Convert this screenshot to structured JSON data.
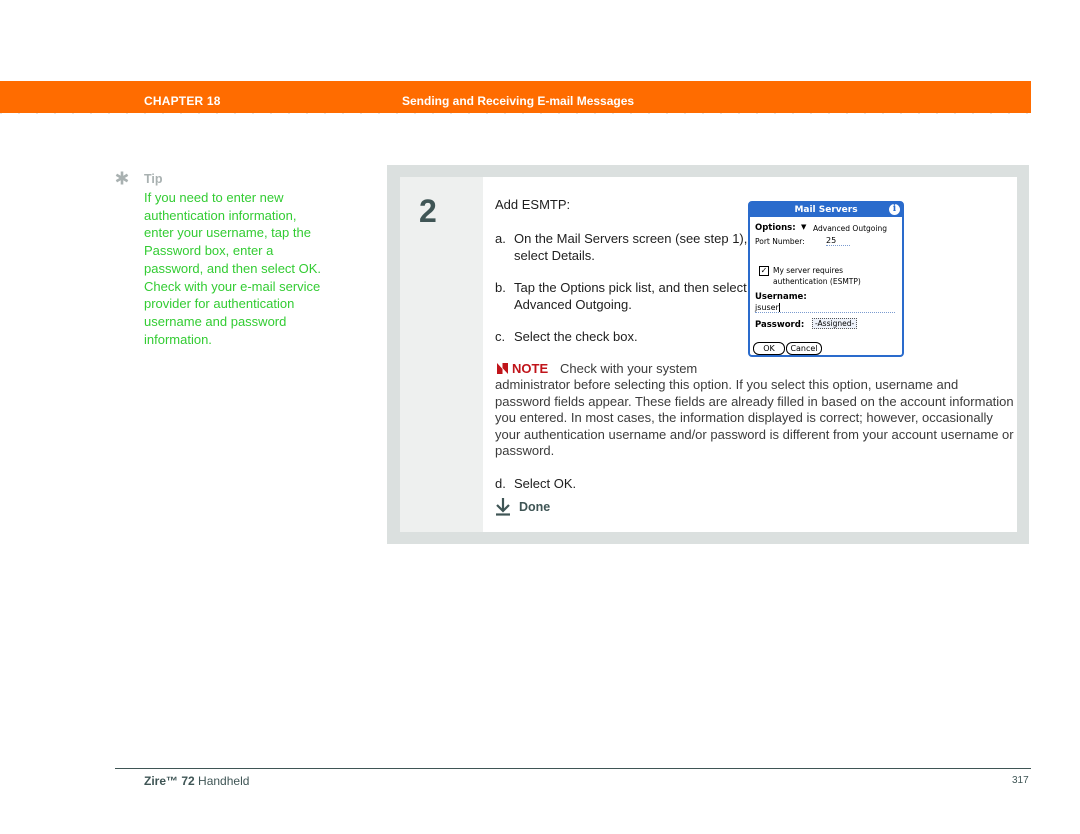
{
  "header": {
    "chapter": "CHAPTER 18",
    "title": "Sending and Receiving E-mail Messages",
    "bar_color": "#ff6c00"
  },
  "tip": {
    "icon": "asterisk-icon",
    "label": "Tip",
    "text": "If you need to enter new authentication information, enter your username, tap the Password box, enter a password, and then select OK. Check with your e-mail service provider for authentication username and password information.",
    "text_color": "#33cc33"
  },
  "step": {
    "number": "2",
    "intro": "Add ESMTP:",
    "items": [
      {
        "marker": "a.",
        "text": "On the Mail Servers screen (see step 1), select Details."
      },
      {
        "marker": "b.",
        "text": "Tap the Options pick list, and then select Advanced Outgoing."
      },
      {
        "marker": "c.",
        "text": "Select the check box."
      },
      {
        "marker": "d.",
        "text": "Select OK."
      }
    ],
    "note": {
      "icon": "note-icon",
      "label": "NOTE",
      "lead": "Check with your system",
      "body": "administrator before selecting this option. If you select this option, username and password fields appear. These fields are already filled in based on the account information you entered. In most cases, the information displayed is correct; however, occasionally your authentication username and/or password is different from your account username or password.",
      "color": "#c0141a"
    },
    "done": {
      "icon": "done-arrow-icon",
      "label": "Done"
    }
  },
  "palm_screen": {
    "title": "Mail Servers",
    "info_glyph": "i",
    "options_label": "Options:",
    "options_arrow": "▼",
    "options_value": "Advanced Outgoing",
    "port_label": "Port Number:",
    "port_value": "25",
    "checkbox_checked": true,
    "checkbox_glyph": "✓",
    "checkbox_label": "My server requires authentication (ESMTP)",
    "username_label": "Username:",
    "username_value": "jsuser",
    "password_label": "Password:",
    "password_value": "-Assigned-",
    "ok_button": "OK",
    "cancel_button": "Cancel",
    "accent": "#2a6bcc"
  },
  "footer": {
    "brand": "Zire™ 72",
    "product": " Handheld",
    "page": "317"
  }
}
